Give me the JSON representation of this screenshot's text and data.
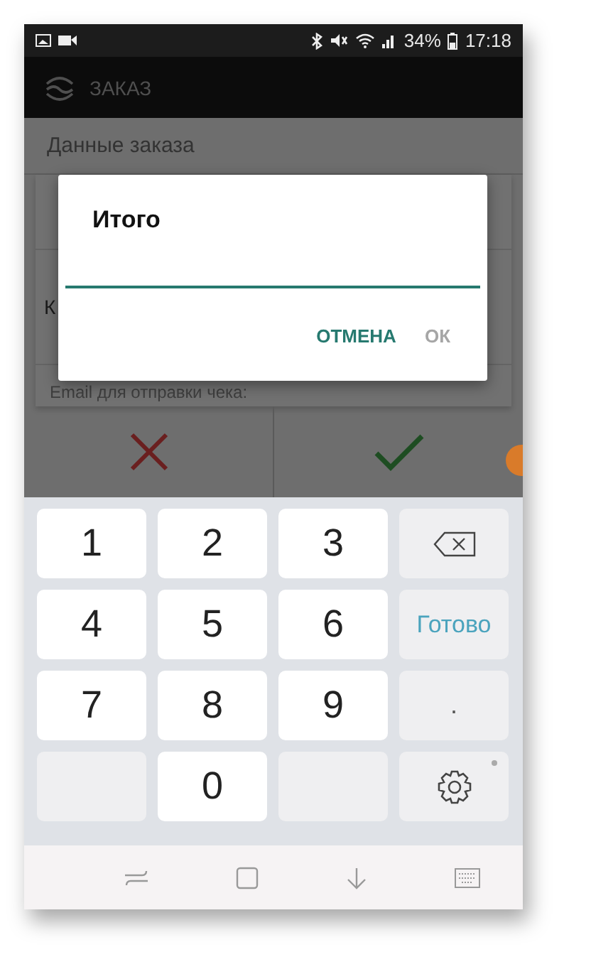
{
  "status_bar": {
    "battery": "34%",
    "time": "17:18"
  },
  "app_bar": {
    "title": "ЗАКАЗ"
  },
  "section": {
    "title": "Данные заказа"
  },
  "form": {
    "field_label": "К",
    "email_label": "Email для отправки чека:"
  },
  "actions": [
    {
      "kind": "cancel"
    },
    {
      "kind": "confirm"
    }
  ],
  "dialog": {
    "title": "Итого",
    "buttons": [
      {
        "label": "ОТМЕНА",
        "disabled": false
      },
      {
        "label": "ОК",
        "disabled": true
      }
    ]
  },
  "keyboard": {
    "keys": [
      {
        "kind": "digit",
        "label": "1"
      },
      {
        "kind": "digit",
        "label": "2"
      },
      {
        "kind": "digit",
        "label": "3"
      },
      {
        "kind": "backspace"
      },
      {
        "kind": "digit",
        "label": "4"
      },
      {
        "kind": "digit",
        "label": "5"
      },
      {
        "kind": "digit",
        "label": "6"
      },
      {
        "kind": "action",
        "label": "Готово"
      },
      {
        "kind": "digit",
        "label": "7"
      },
      {
        "kind": "digit",
        "label": "8"
      },
      {
        "kind": "digit",
        "label": "9"
      },
      {
        "kind": "symbol",
        "label": "."
      },
      {
        "kind": "blank"
      },
      {
        "kind": "digit",
        "label": "0"
      },
      {
        "kind": "blank"
      },
      {
        "kind": "settings"
      }
    ]
  }
}
